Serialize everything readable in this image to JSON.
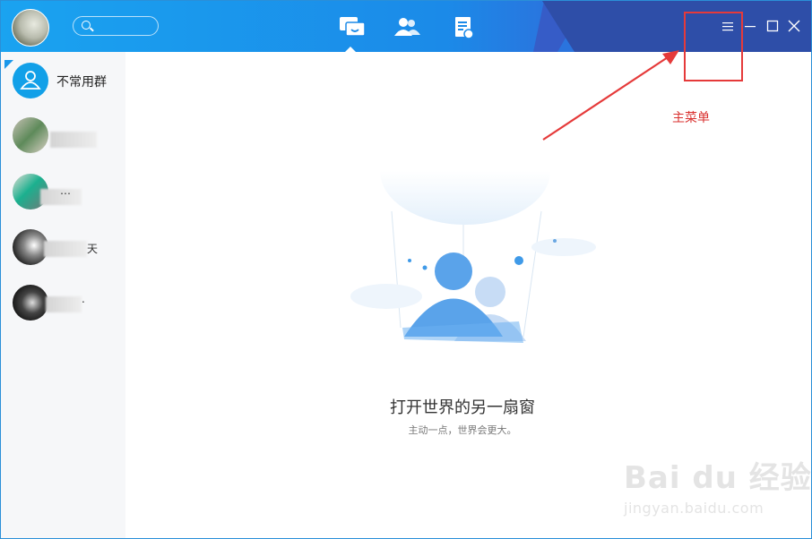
{
  "sidebar": {
    "group_label": "不常用群",
    "contacts": [
      {
        "name_stamp": ""
      },
      {
        "name_stamp": "…"
      },
      {
        "name_stamp": "天"
      },
      {
        "name_stamp": "."
      }
    ]
  },
  "main": {
    "title": "打开世界的另一扇窗",
    "subtitle": "主动一点，世界会更大。"
  },
  "annotation": {
    "label": "主菜单"
  },
  "watermark": {
    "brand": "Bai du 经验",
    "url": "jingyan.baidu.com"
  },
  "colors": {
    "titlebar": "#1b8ae8",
    "annotation": "#e53a3a",
    "group_avatar": "#12a0e8"
  },
  "icons": {
    "search": "search-icon",
    "messages": "chat-bubbles-icon",
    "contacts": "contacts-icon",
    "spaces": "document-icon",
    "menu": "hamburger-menu-icon",
    "minimize": "minimize-icon",
    "maximize": "maximize-icon",
    "close": "close-icon"
  }
}
